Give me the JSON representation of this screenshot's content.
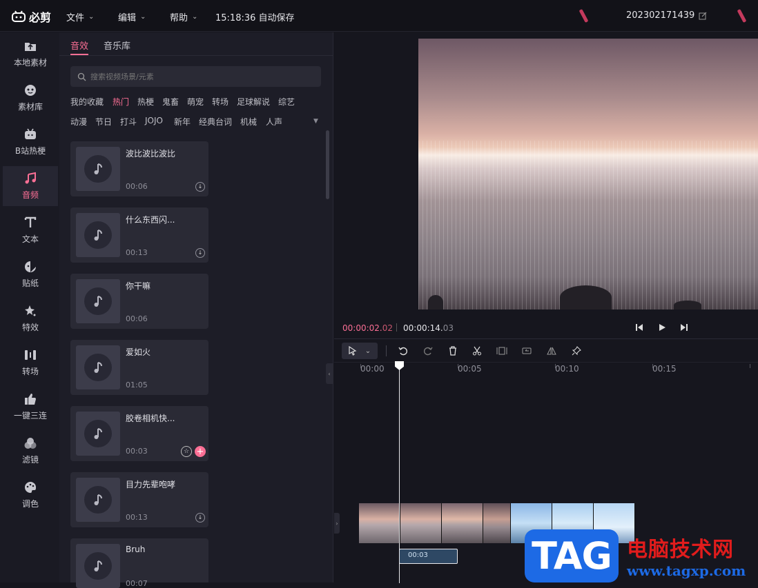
{
  "app": {
    "name": "必剪"
  },
  "topbar": {
    "menus": [
      "文件",
      "编辑",
      "帮助"
    ],
    "autosave": "15:18:36 自动保存",
    "project_name": "202302171439"
  },
  "leftnav": {
    "items": [
      {
        "label": "本地素材",
        "icon": "upload-folder-icon"
      },
      {
        "label": "素材库",
        "icon": "material-library-icon"
      },
      {
        "label": "B站热梗",
        "icon": "bilibili-tv-icon"
      },
      {
        "label": "音频",
        "icon": "music-note-icon"
      },
      {
        "label": "文本",
        "icon": "text-icon"
      },
      {
        "label": "贴纸",
        "icon": "sticker-icon"
      },
      {
        "label": "特效",
        "icon": "effect-star-icon"
      },
      {
        "label": "转场",
        "icon": "transition-icon"
      },
      {
        "label": "一键三连",
        "icon": "thumbs-up-icon"
      },
      {
        "label": "滤镜",
        "icon": "filter-icon"
      },
      {
        "label": "调色",
        "icon": "palette-icon"
      }
    ],
    "active_index": 3
  },
  "panel": {
    "tabs": [
      "音效",
      "音乐库"
    ],
    "active_tab": 0,
    "search_placeholder": "搜索视频场景/元素",
    "categories_row1": [
      "我的收藏",
      "热门",
      "热梗",
      "鬼畜",
      "萌宠",
      "转场",
      "足球解说",
      "综艺"
    ],
    "categories_row2": [
      "动漫",
      "节日",
      "打斗",
      "JOJO",
      "新年",
      "经典台词",
      "机械",
      "人声"
    ],
    "active_category": "热门",
    "sounds": [
      {
        "title": "波比波比波比",
        "duration": "00:06"
      },
      {
        "title": "什么东西闪...",
        "duration": "00:13"
      },
      {
        "title": "你干嘛",
        "duration": "00:06"
      },
      {
        "title": "爱如火",
        "duration": "01:05"
      },
      {
        "title": "胶卷相机快...",
        "duration": "00:03"
      },
      {
        "title": "目力先辈咆哮",
        "duration": "00:13"
      },
      {
        "title": "Bruh",
        "duration": "00:07"
      }
    ]
  },
  "player": {
    "current_main": "00:00:02.",
    "current_frac": "02",
    "total_main": "00:00:14.",
    "total_frac": "03"
  },
  "timeline": {
    "ruler": [
      "00:00",
      "00:05",
      "00:10",
      "00:15"
    ],
    "audio_clip_label": "00:03"
  },
  "watermark": {
    "logo": "TAG",
    "title": "电脑技术网",
    "url": "www.tagxp.com"
  },
  "colors": {
    "accent": "#fb6f95",
    "panel": "#1d1d27",
    "background": "#16161e"
  }
}
